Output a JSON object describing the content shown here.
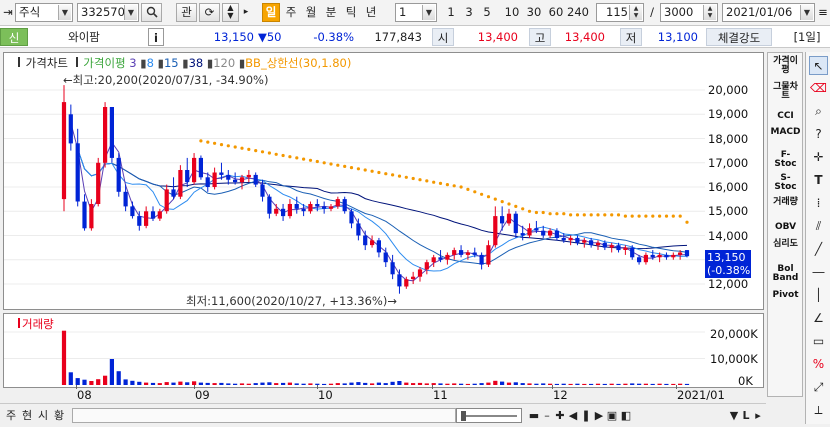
{
  "toolbar": {
    "market": "주식",
    "code": "332570",
    "search_icon": "search-icon",
    "watch_label": "관",
    "period_buttons": [
      "일",
      "주",
      "월",
      "분",
      "틱",
      "년"
    ],
    "selected_period": "일",
    "interval_value": "1",
    "interval_buttons": [
      "1",
      "3",
      "5",
      "10",
      "30",
      "60",
      "240"
    ],
    "count_value": "115",
    "count_sep": "/",
    "total_value": "3000",
    "date_value": "2021/01/06"
  },
  "quote": {
    "flag_label": "신",
    "name": "와이팜",
    "info_label": "i",
    "price": "13,150",
    "change": "▼50",
    "change_pct": "-0.38%",
    "volume": "177,843",
    "open_label": "시",
    "open": "13,400",
    "high_label": "고",
    "high": "13,400",
    "low_label": "저",
    "low": "13,100",
    "strength_label": "체결강도",
    "period_label": "[1일]"
  },
  "legend": {
    "price_chart": "가격차트",
    "ma_label": "가격이평",
    "ma_periods": [
      "3",
      "8",
      "15",
      "38",
      "120"
    ],
    "bb_label": "BB_상한선(30,1.80)"
  },
  "annotations": {
    "high": "←최고:20,200(2020/07/31, -34.90%)",
    "low": "최저:11,600(2020/10/27, +13.36%)→"
  },
  "price_axis": [
    "20,000",
    "19,000",
    "18,000",
    "17,000",
    "16,000",
    "15,000",
    "14,000",
    "13,000",
    "12,000"
  ],
  "current_badge": {
    "price": "13,150",
    "pct": "(-0.38%)"
  },
  "volume_panel": {
    "title": "거래량",
    "axis": [
      "20,000K",
      "10,000K",
      "0K"
    ]
  },
  "x_axis": [
    "08",
    "09",
    "10",
    "11",
    "12",
    "2021/01"
  ],
  "colors": {
    "up": "#e8001c",
    "down": "#0024d6",
    "bb": "#f39800",
    "ma3": "#5a3fb5",
    "ma8": "#2d8cf0",
    "ma15": "#1a5fb4",
    "ma38": "#00137a",
    "ma120": "#8a8a8a"
  },
  "right_indicators": [
    "가격이평",
    "그물차트",
    "CCI",
    "MACD",
    "F-Stoc",
    "S-Stoc",
    "거래량",
    "OBV",
    "심리도",
    "Bol Band",
    "Pivot"
  ],
  "bottom": {
    "left_buttons": [
      "주",
      "현",
      "시",
      "황"
    ]
  },
  "chart_data": {
    "type": "candlestick",
    "x_labels": [
      "08",
      "09",
      "10",
      "11",
      "12",
      "2021/01"
    ],
    "ylim": [
      11500,
      20500
    ],
    "candles": [
      {
        "o": 15500,
        "h": 20200,
        "l": 15000,
        "c": 19500
      },
      {
        "o": 19000,
        "h": 19400,
        "l": 17500,
        "c": 17800
      },
      {
        "o": 17800,
        "h": 18400,
        "l": 15200,
        "c": 15400
      },
      {
        "o": 15400,
        "h": 15700,
        "l": 14200,
        "c": 14300
      },
      {
        "o": 14300,
        "h": 15500,
        "l": 14200,
        "c": 15300
      },
      {
        "o": 15300,
        "h": 17200,
        "l": 15200,
        "c": 17000
      },
      {
        "o": 17000,
        "h": 19500,
        "l": 16800,
        "c": 19300
      },
      {
        "o": 19300,
        "h": 19300,
        "l": 17000,
        "c": 17200
      },
      {
        "o": 17200,
        "h": 17400,
        "l": 15600,
        "c": 15800
      },
      {
        "o": 15800,
        "h": 16100,
        "l": 15000,
        "c": 15200
      },
      {
        "o": 15200,
        "h": 15400,
        "l": 14700,
        "c": 14800
      },
      {
        "o": 14800,
        "h": 15000,
        "l": 14200,
        "c": 14400
      },
      {
        "o": 14400,
        "h": 15200,
        "l": 14300,
        "c": 15000
      },
      {
        "o": 15000,
        "h": 15200,
        "l": 14600,
        "c": 14700
      },
      {
        "o": 14700,
        "h": 15100,
        "l": 14600,
        "c": 15000
      },
      {
        "o": 15000,
        "h": 16100,
        "l": 14900,
        "c": 15900
      },
      {
        "o": 15900,
        "h": 16400,
        "l": 15500,
        "c": 15600
      },
      {
        "o": 15600,
        "h": 16900,
        "l": 15500,
        "c": 16700
      },
      {
        "o": 16700,
        "h": 17200,
        "l": 16000,
        "c": 16200
      },
      {
        "o": 16200,
        "h": 17400,
        "l": 16100,
        "c": 17200
      },
      {
        "o": 17200,
        "h": 17300,
        "l": 16300,
        "c": 16400
      },
      {
        "o": 16400,
        "h": 16600,
        "l": 15800,
        "c": 16000
      },
      {
        "o": 16000,
        "h": 16800,
        "l": 15900,
        "c": 16600
      },
      {
        "o": 16600,
        "h": 17000,
        "l": 16300,
        "c": 16500
      },
      {
        "o": 16500,
        "h": 16700,
        "l": 16100,
        "c": 16300
      },
      {
        "o": 16300,
        "h": 16600,
        "l": 16100,
        "c": 16200
      },
      {
        "o": 16200,
        "h": 16500,
        "l": 15900,
        "c": 16400
      },
      {
        "o": 16400,
        "h": 16700,
        "l": 16200,
        "c": 16500
      },
      {
        "o": 16500,
        "h": 16600,
        "l": 16000,
        "c": 16100
      },
      {
        "o": 16100,
        "h": 16300,
        "l": 15400,
        "c": 15600
      },
      {
        "o": 15600,
        "h": 15700,
        "l": 14700,
        "c": 14900
      },
      {
        "o": 14900,
        "h": 15300,
        "l": 14800,
        "c": 15100
      },
      {
        "o": 15100,
        "h": 15300,
        "l": 14600,
        "c": 14800
      },
      {
        "o": 14800,
        "h": 15500,
        "l": 14700,
        "c": 15300
      },
      {
        "o": 15300,
        "h": 15600,
        "l": 14900,
        "c": 15100
      },
      {
        "o": 15100,
        "h": 15300,
        "l": 14800,
        "c": 15000
      },
      {
        "o": 15000,
        "h": 15400,
        "l": 14900,
        "c": 15300
      },
      {
        "o": 15300,
        "h": 15500,
        "l": 15000,
        "c": 15200
      },
      {
        "o": 15200,
        "h": 15400,
        "l": 14900,
        "c": 15100
      },
      {
        "o": 15100,
        "h": 15300,
        "l": 15000,
        "c": 15200
      },
      {
        "o": 15200,
        "h": 15600,
        "l": 15100,
        "c": 15500
      },
      {
        "o": 15500,
        "h": 15600,
        "l": 14900,
        "c": 15000
      },
      {
        "o": 15000,
        "h": 15100,
        "l": 14300,
        "c": 14500
      },
      {
        "o": 14500,
        "h": 14700,
        "l": 13800,
        "c": 14000
      },
      {
        "o": 14000,
        "h": 14200,
        "l": 13400,
        "c": 13600
      },
      {
        "o": 13600,
        "h": 14000,
        "l": 13500,
        "c": 13800
      },
      {
        "o": 13800,
        "h": 13900,
        "l": 13100,
        "c": 13300
      },
      {
        "o": 13300,
        "h": 13500,
        "l": 12700,
        "c": 12900
      },
      {
        "o": 12900,
        "h": 13200,
        "l": 12200,
        "c": 12400
      },
      {
        "o": 12400,
        "h": 12600,
        "l": 11600,
        "c": 11900
      },
      {
        "o": 11900,
        "h": 12300,
        "l": 11800,
        "c": 12200
      },
      {
        "o": 12200,
        "h": 12500,
        "l": 12000,
        "c": 12300
      },
      {
        "o": 12300,
        "h": 12700,
        "l": 12100,
        "c": 12600
      },
      {
        "o": 12600,
        "h": 13000,
        "l": 12400,
        "c": 12900
      },
      {
        "o": 12900,
        "h": 13200,
        "l": 12700,
        "c": 13100
      },
      {
        "o": 13100,
        "h": 13400,
        "l": 12900,
        "c": 13000
      },
      {
        "o": 13000,
        "h": 13300,
        "l": 12800,
        "c": 13200
      },
      {
        "o": 13200,
        "h": 13500,
        "l": 13000,
        "c": 13400
      },
      {
        "o": 13400,
        "h": 13600,
        "l": 13100,
        "c": 13200
      },
      {
        "o": 13200,
        "h": 13400,
        "l": 13000,
        "c": 13300
      },
      {
        "o": 13300,
        "h": 13500,
        "l": 13100,
        "c": 13200
      },
      {
        "o": 13200,
        "h": 13300,
        "l": 12600,
        "c": 12800
      },
      {
        "o": 12800,
        "h": 13800,
        "l": 12700,
        "c": 13600
      },
      {
        "o": 13600,
        "h": 15200,
        "l": 13500,
        "c": 14800
      },
      {
        "o": 14800,
        "h": 15200,
        "l": 14200,
        "c": 14500
      },
      {
        "o": 14500,
        "h": 15100,
        "l": 14400,
        "c": 14900
      },
      {
        "o": 14900,
        "h": 15000,
        "l": 13900,
        "c": 14100
      },
      {
        "o": 14100,
        "h": 14400,
        "l": 13800,
        "c": 14000
      },
      {
        "o": 14000,
        "h": 14500,
        "l": 13900,
        "c": 14300
      },
      {
        "o": 14300,
        "h": 14600,
        "l": 14100,
        "c": 14200
      },
      {
        "o": 14200,
        "h": 14400,
        "l": 13900,
        "c": 14000
      },
      {
        "o": 14000,
        "h": 14300,
        "l": 13900,
        "c": 14200
      },
      {
        "o": 14200,
        "h": 14300,
        "l": 13800,
        "c": 13900
      },
      {
        "o": 13900,
        "h": 14100,
        "l": 13700,
        "c": 13800
      },
      {
        "o": 13800,
        "h": 14000,
        "l": 13600,
        "c": 13900
      },
      {
        "o": 13900,
        "h": 14000,
        "l": 13600,
        "c": 13700
      },
      {
        "o": 13700,
        "h": 13900,
        "l": 13500,
        "c": 13800
      },
      {
        "o": 13800,
        "h": 13900,
        "l": 13500,
        "c": 13600
      },
      {
        "o": 13600,
        "h": 13800,
        "l": 13400,
        "c": 13700
      },
      {
        "o": 13700,
        "h": 13800,
        "l": 13400,
        "c": 13500
      },
      {
        "o": 13500,
        "h": 13700,
        "l": 13300,
        "c": 13600
      },
      {
        "o": 13600,
        "h": 13700,
        "l": 13300,
        "c": 13400
      },
      {
        "o": 13400,
        "h": 13600,
        "l": 13200,
        "c": 13500
      },
      {
        "o": 13500,
        "h": 13600,
        "l": 13000,
        "c": 13100
      },
      {
        "o": 13100,
        "h": 13200,
        "l": 12800,
        "c": 12900
      },
      {
        "o": 12900,
        "h": 13300,
        "l": 12800,
        "c": 13200
      },
      {
        "o": 13200,
        "h": 13400,
        "l": 13000,
        "c": 13100
      },
      {
        "o": 13100,
        "h": 13300,
        "l": 12900,
        "c": 13200
      },
      {
        "o": 13200,
        "h": 13300,
        "l": 13000,
        "c": 13100
      },
      {
        "o": 13100,
        "h": 13300,
        "l": 13000,
        "c": 13200
      },
      {
        "o": 13200,
        "h": 13400,
        "l": 13000,
        "c": 13300
      },
      {
        "o": 13400,
        "h": 13400,
        "l": 13100,
        "c": 13150
      }
    ],
    "volume_unit": "K",
    "volume_ylim": [
      0,
      22000
    ],
    "volumes": [
      20500,
      4800,
      2600,
      2000,
      1500,
      2200,
      3500,
      9800,
      5200,
      2100,
      1600,
      1200,
      900,
      800,
      700,
      1100,
      900,
      1300,
      1000,
      1400,
      900,
      800,
      700,
      800,
      600,
      500,
      600,
      500,
      700,
      900,
      1000,
      700,
      800,
      900,
      600,
      500,
      600,
      500,
      400,
      500,
      700,
      600,
      900,
      1100,
      800,
      600,
      900,
      700,
      1200,
      1500,
      900,
      700,
      800,
      600,
      700,
      600,
      500,
      600,
      500,
      400,
      500,
      700,
      900,
      1600,
      1300,
      900,
      1000,
      700,
      600,
      500,
      600,
      500,
      400,
      500,
      400,
      500,
      400,
      400,
      500,
      400,
      500,
      400,
      500,
      600,
      500,
      500,
      400,
      500,
      400,
      400,
      500,
      400
    ],
    "bb_upper": [
      null,
      null,
      null,
      null,
      null,
      null,
      null,
      null,
      null,
      null,
      null,
      null,
      null,
      null,
      null,
      null,
      null,
      null,
      null,
      null,
      17900,
      17850,
      17800,
      17750,
      17700,
      17650,
      17600,
      17550,
      17500,
      17450,
      17400,
      17350,
      17300,
      17250,
      17200,
      17150,
      17100,
      17050,
      17000,
      16950,
      16900,
      16850,
      16800,
      16750,
      16700,
      16650,
      16600,
      16550,
      16500,
      16450,
      16400,
      16350,
      16300,
      16250,
      16200,
      16150,
      16100,
      16050,
      16000,
      15900,
      15800,
      15700,
      15600,
      15500,
      15400,
      15300,
      15200,
      15100,
      15000,
      14950,
      14950,
      14900,
      14900,
      14900,
      14850,
      14850,
      14850,
      14850,
      14850,
      14850,
      14850,
      14850,
      14800,
      14800,
      14800,
      14800,
      14800,
      14800,
      14800,
      14800,
      14800,
      14550
    ]
  }
}
